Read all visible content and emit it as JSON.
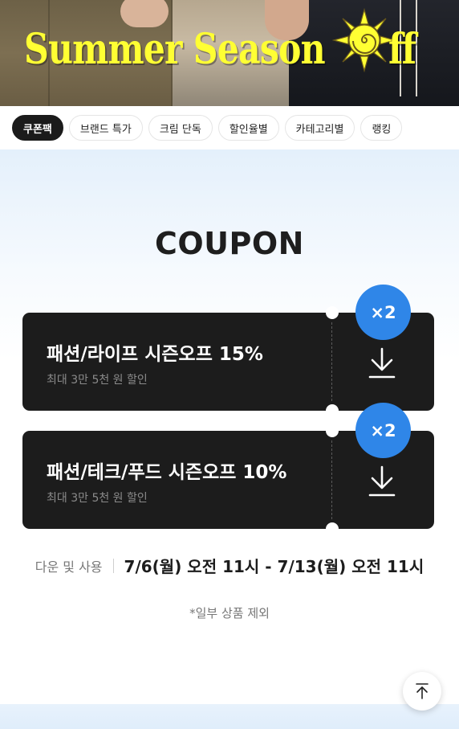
{
  "banner": {
    "title": "Summer Season ",
    "title_tail": "ff",
    "colors": {
      "title": "#ffff33",
      "sun": "#ffff33"
    },
    "icon": "sun-logo"
  },
  "tabs": [
    {
      "label": "쿠폰팩",
      "active": true
    },
    {
      "label": "브랜드 특가",
      "active": false
    },
    {
      "label": "크림 단독",
      "active": false
    },
    {
      "label": "할인율별",
      "active": false
    },
    {
      "label": "카테고리별",
      "active": false
    },
    {
      "label": "랭킹",
      "active": false
    }
  ],
  "coupon_section": {
    "heading": "COUPON",
    "coupons": [
      {
        "title": "패션/라이프 시즌오프 15%",
        "subtitle": "최대 3만 5천 원 할인",
        "badge": "×2",
        "icon": "download-icon"
      },
      {
        "title": "패션/테크/푸드 시즌오프 10%",
        "subtitle": "최대 3만 5천 원 할인",
        "badge": "×2",
        "icon": "download-icon"
      }
    ],
    "period_label": "다운 및 사용",
    "period_value": "7/6(월) 오전 11시 - 7/13(월) 오전 11시",
    "note": "*일부 상품 제외"
  },
  "scroll_top": {
    "icon": "arrow-up-icon"
  },
  "colors": {
    "accent": "#2f86e8",
    "card": "#1c1c1c",
    "active_tab": "#1b1b1b"
  }
}
